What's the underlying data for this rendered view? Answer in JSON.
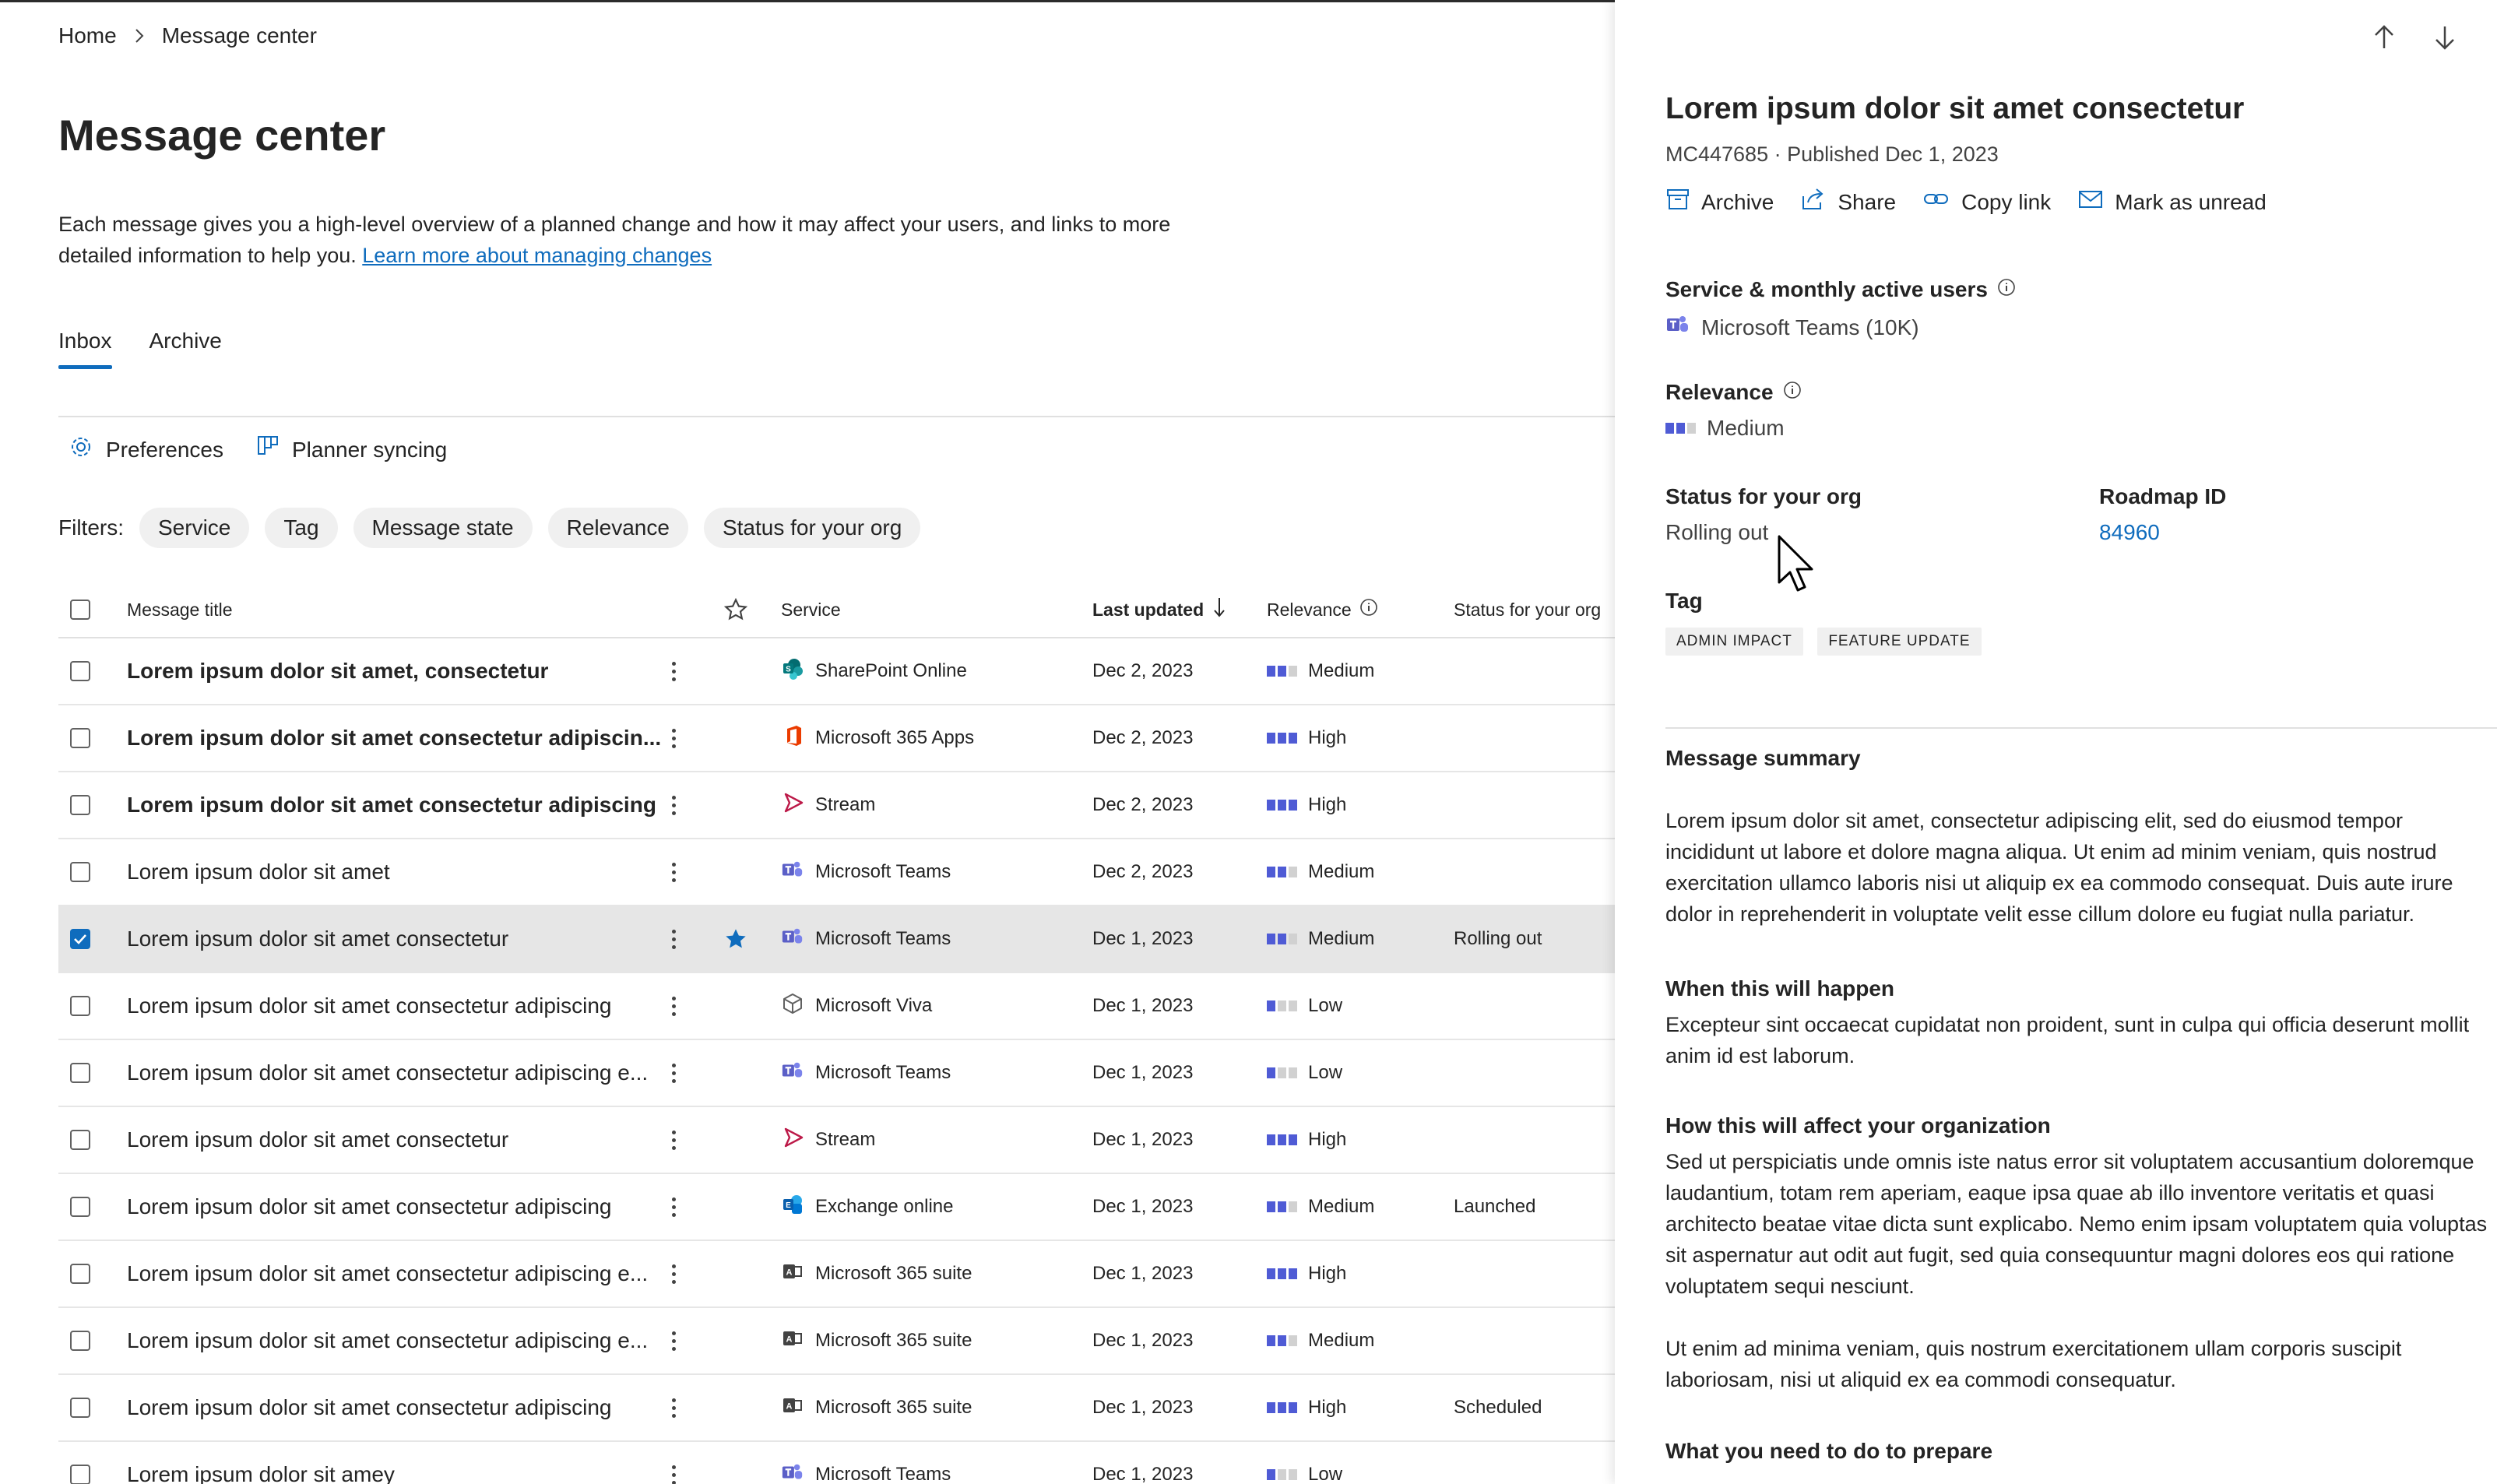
{
  "breadcrumb": {
    "home": "Home",
    "current": "Message center"
  },
  "page": {
    "title": "Message center",
    "description": "Each message gives you a high-level overview of a planned change and how it may affect your users, and links to more detailed information to help you.",
    "learn_more": "Learn more about managing changes"
  },
  "tabs": [
    {
      "label": "Inbox",
      "active": true
    },
    {
      "label": "Archive",
      "active": false
    }
  ],
  "toolbar": {
    "preferences": "Preferences",
    "planner": "Planner syncing"
  },
  "filters": {
    "label": "Filters:",
    "chips": [
      "Service",
      "Tag",
      "Message state",
      "Relevance",
      "Status for your org"
    ]
  },
  "table": {
    "headers": {
      "title": "Message title",
      "service": "Service",
      "updated": "Last updated",
      "relevance": "Relevance",
      "status": "Status for your org"
    },
    "rows": [
      {
        "title": "Lorem ipsum dolor sit amet, consectetur",
        "bold": true,
        "service": "SharePoint Online",
        "icon": "sharepoint-icon",
        "date": "Dec 2, 2023",
        "relevance": "Medium",
        "level": 2,
        "status": "",
        "checked": false,
        "starred": false
      },
      {
        "title": "Lorem ipsum dolor sit amet consectetur adipiscin...",
        "bold": true,
        "service": "Microsoft 365 Apps",
        "icon": "office-icon",
        "date": "Dec 2, 2023",
        "relevance": "High",
        "level": 3,
        "status": "",
        "checked": false,
        "starred": false
      },
      {
        "title": "Lorem ipsum dolor sit amet consectetur adipiscing",
        "bold": true,
        "service": "Stream",
        "icon": "stream-icon",
        "date": "Dec 2, 2023",
        "relevance": "High",
        "level": 3,
        "status": "",
        "checked": false,
        "starred": false
      },
      {
        "title": "Lorem ipsum dolor sit amet",
        "bold": false,
        "service": "Microsoft Teams",
        "icon": "teams-icon",
        "date": "Dec 2, 2023",
        "relevance": "Medium",
        "level": 2,
        "status": "",
        "checked": false,
        "starred": false
      },
      {
        "title": "Lorem ipsum dolor sit amet consectetur",
        "bold": false,
        "service": "Microsoft Teams",
        "icon": "teams-icon",
        "date": "Dec 1, 2023",
        "relevance": "Medium",
        "level": 2,
        "status": "Rolling out",
        "checked": true,
        "starred": true
      },
      {
        "title": "Lorem ipsum dolor sit amet consectetur adipiscing",
        "bold": false,
        "service": "Microsoft Viva",
        "icon": "viva-icon",
        "date": "Dec 1, 2023",
        "relevance": "Low",
        "level": 1,
        "status": "",
        "checked": false,
        "starred": false
      },
      {
        "title": "Lorem ipsum dolor sit amet consectetur adipiscing e...",
        "bold": false,
        "service": "Microsoft Teams",
        "icon": "teams-icon",
        "date": "Dec 1, 2023",
        "relevance": "Low",
        "level": 1,
        "status": "",
        "checked": false,
        "starred": false
      },
      {
        "title": "Lorem ipsum dolor sit amet consectetur",
        "bold": false,
        "service": "Stream",
        "icon": "stream-icon",
        "date": "Dec 1, 2023",
        "relevance": "High",
        "level": 3,
        "status": "",
        "checked": false,
        "starred": false
      },
      {
        "title": "Lorem ipsum dolor sit amet consectetur adipiscing",
        "bold": false,
        "service": "Exchange online",
        "icon": "exchange-icon",
        "date": "Dec 1, 2023",
        "relevance": "Medium",
        "level": 2,
        "status": "Launched",
        "checked": false,
        "starred": false
      },
      {
        "title": "Lorem ipsum dolor sit amet consectetur adipiscing e...",
        "bold": false,
        "service": "Microsoft 365 suite",
        "icon": "m365-suite-icon",
        "date": "Dec 1, 2023",
        "relevance": "High",
        "level": 3,
        "status": "",
        "checked": false,
        "starred": false
      },
      {
        "title": "Lorem ipsum dolor sit amet consectetur adipiscing e...",
        "bold": false,
        "service": "Microsoft 365 suite",
        "icon": "m365-suite-icon",
        "date": "Dec 1, 2023",
        "relevance": "Medium",
        "level": 2,
        "status": "",
        "checked": false,
        "starred": false
      },
      {
        "title": "Lorem ipsum dolor sit amet consectetur adipiscing",
        "bold": false,
        "service": "Microsoft 365 suite",
        "icon": "m365-suite-icon",
        "date": "Dec 1, 2023",
        "relevance": "High",
        "level": 3,
        "status": "Scheduled",
        "checked": false,
        "starred": false
      },
      {
        "title": "Lorem ipsum dolor sit amey",
        "bold": false,
        "service": "Microsoft Teams",
        "icon": "teams-icon",
        "date": "Dec 1, 2023",
        "relevance": "Low",
        "level": 1,
        "status": "",
        "checked": false,
        "starred": false
      }
    ]
  },
  "panel": {
    "title": "Lorem ipsum dolor sit amet consectetur",
    "meta": "MC447685 · Published Dec 1, 2023",
    "actions": {
      "archive": "Archive",
      "share": "Share",
      "copy": "Copy link",
      "unread": "Mark as unread"
    },
    "service_label": "Service & monthly active users",
    "service_value": "Microsoft Teams (10K)",
    "relevance_label": "Relevance",
    "relevance_value": "Medium",
    "relevance_level": 2,
    "status_label": "Status for your org",
    "status_value": "Rolling out",
    "roadmap_label": "Roadmap ID",
    "roadmap_value": "84960",
    "tag_label": "Tag",
    "tags": [
      "ADMIN IMPACT",
      "FEATURE UPDATE"
    ],
    "summary_heading": "Message summary",
    "summary_text": "Lorem ipsum dolor sit amet, consectetur adipiscing elit, sed do eiusmod tempor incididunt ut labore et dolore magna aliqua. Ut enim ad minim veniam, quis nostrud exercitation ullamco laboris nisi ut aliquip ex ea commodo consequat. Duis aute irure dolor in reprehenderit in voluptate velit esse cillum dolore eu fugiat nulla pariatur.",
    "when_heading": "When this will happen",
    "when_text": "Excepteur sint occaecat cupidatat non proident, sunt in culpa qui officia deserunt mollit anim id est laborum.",
    "affect_heading": "How this will affect your organization",
    "affect_text_1": "Sed ut perspiciatis unde omnis iste natus error sit voluptatem accusantium doloremque laudantium, totam rem aperiam, eaque ipsa quae ab illo inventore veritatis et quasi architecto beatae vitae dicta sunt explicabo. Nemo enim ipsam voluptatem quia voluptas sit aspernatur aut odit aut fugit, sed quia consequuntur magni dolores eos qui ratione voluptatem sequi nesciunt.",
    "affect_text_2": "Ut enim ad minima veniam, quis nostrum exercitationem ullam corporis suscipit laboriosam, nisi ut aliquid ex ea commodi consequatur.",
    "prepare_heading": "What you need to do to prepare"
  },
  "colors": {
    "accent": "#0f6cbd",
    "relevance_on": "#4f5bd5",
    "relevance_off": "#d1d1d1",
    "selected_row": "#e6e6e6",
    "chip": "#f0f0f0"
  }
}
